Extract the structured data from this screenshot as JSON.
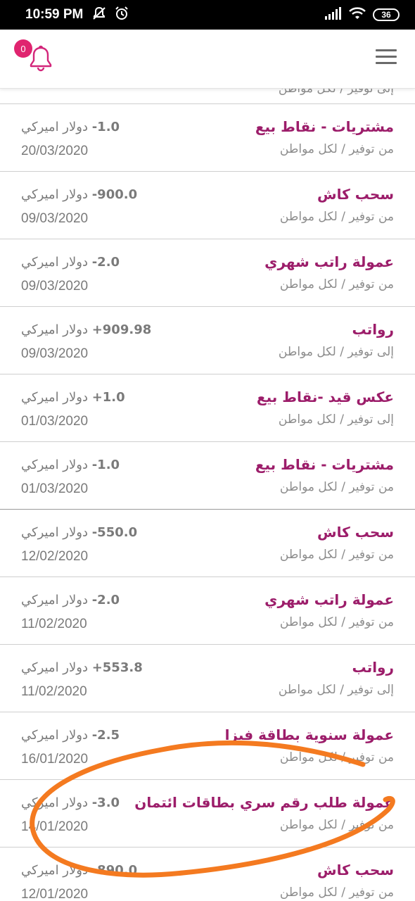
{
  "status_bar": {
    "time": "10:59 PM",
    "battery": "36",
    "icons": [
      "mute-icon",
      "alarm-icon",
      "signal-icon",
      "wifi-icon",
      "battery-icon"
    ]
  },
  "app_bar": {
    "notification_count": "0",
    "notification_icon": "bell-icon",
    "menu_icon": "hamburger-menu-icon",
    "accent_color": "#e0246f",
    "title_color": "#9c1d6a"
  },
  "partial_top": "إلى توفير / لكل مواطن",
  "transactions": [
    {
      "title": "مشتريات - نقاط بيع",
      "subtitle": "من توفير / لكل مواطن",
      "amount_value": "-1.0",
      "currency": "دولار اميركي",
      "date": "20/03/2020"
    },
    {
      "title": "سحب كاش",
      "subtitle": "من توفير / لكل مواطن",
      "amount_value": "-900.0",
      "currency": "دولار اميركي",
      "date": "09/03/2020"
    },
    {
      "title": "عمولة راتب شهري",
      "subtitle": "من توفير / لكل مواطن",
      "amount_value": "-2.0",
      "currency": "دولار اميركي",
      "date": "09/03/2020"
    },
    {
      "title": "رواتب",
      "subtitle": "إلى توفير / لكل مواطن",
      "amount_value": "+909.98",
      "currency": "دولار اميركي",
      "date": "09/03/2020"
    },
    {
      "title": "عكس قيد -نقاط بيع",
      "subtitle": "إلى توفير / لكل مواطن",
      "amount_value": "+1.0",
      "currency": "دولار اميركي",
      "date": "01/03/2020"
    },
    {
      "title": "مشتريات - نقاط بيع",
      "subtitle": "من توفير / لكل مواطن",
      "amount_value": "-1.0",
      "currency": "دولار اميركي",
      "date": "01/03/2020"
    },
    {
      "title": "سحب كاش",
      "subtitle": "من توفير / لكل مواطن",
      "amount_value": "-550.0",
      "currency": "دولار اميركي",
      "date": "12/02/2020"
    },
    {
      "title": "عمولة راتب شهري",
      "subtitle": "من توفير / لكل مواطن",
      "amount_value": "-2.0",
      "currency": "دولار اميركي",
      "date": "11/02/2020"
    },
    {
      "title": "رواتب",
      "subtitle": "إلى توفير / لكل مواطن",
      "amount_value": "+553.8",
      "currency": "دولار اميركي",
      "date": "11/02/2020"
    },
    {
      "title": "عمولة سنوية بطاقة فيزا",
      "subtitle": "من توفير / لكل مواطن",
      "amount_value": "-2.5",
      "currency": "دولار اميركي",
      "date": "16/01/2020"
    },
    {
      "title": "عمولة طلب رقم سري بطاقات ائتمان",
      "subtitle": "من توفير / لكل مواطن",
      "amount_value": "-3.0",
      "currency": "دولار اميركي",
      "date": "14/01/2020"
    },
    {
      "title": "سحب كاش",
      "subtitle": "من توفير / لكل مواطن",
      "amount_value": "-890.0",
      "currency": "دولار اميركي",
      "date": "12/01/2020"
    }
  ],
  "annotation_color": "#f47a20"
}
